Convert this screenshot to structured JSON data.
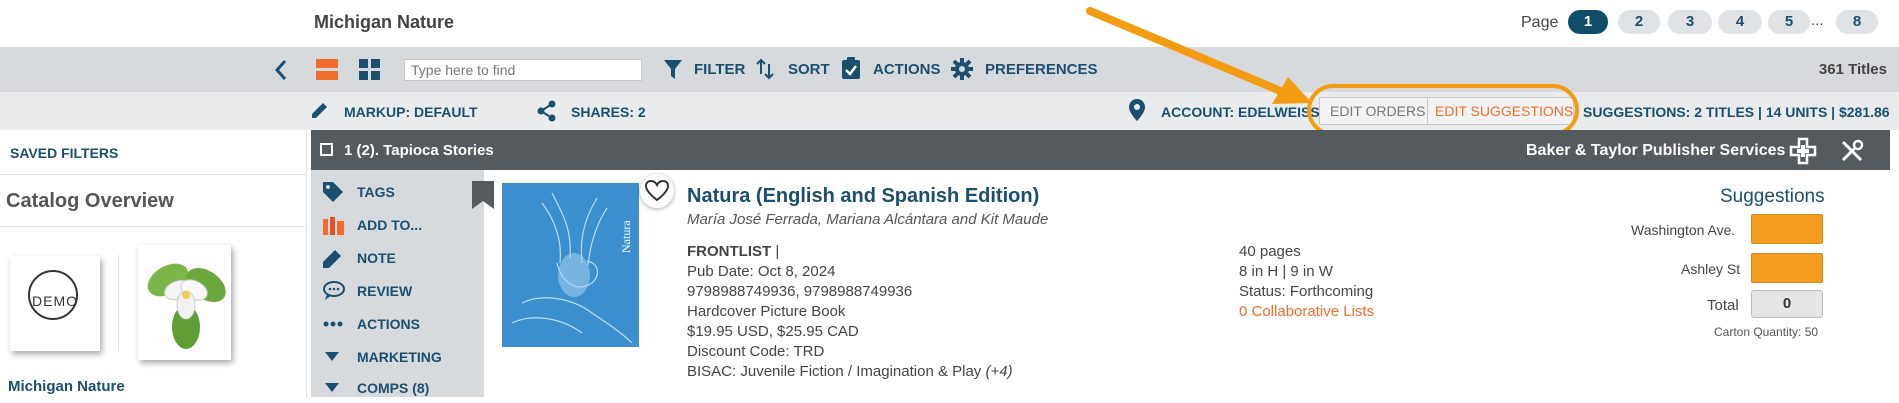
{
  "header": {
    "catalog_title": "Michigan Nature",
    "page_label": "Page",
    "pages": [
      "1",
      "2",
      "3",
      "4",
      "5",
      "8"
    ],
    "active_page": "1",
    "ellipsis": "..."
  },
  "toolbar": {
    "search_placeholder": "Type here to find",
    "filter_label": "FILTER",
    "sort_label": "SORT",
    "actions_label": "ACTIONS",
    "preferences_label": "PREFERENCES",
    "titles_count": "361 Titles"
  },
  "bar2": {
    "markup_label": "MARKUP: DEFAULT",
    "shares_label": "SHARES: 2",
    "account_label": "ACCOUNT: EDELWEISS",
    "edit_orders_label": "EDIT ORDERS",
    "edit_suggestions_label": "EDIT SUGGESTIONS",
    "suggestions_summary": "SUGGESTIONS: 2 TITLES | 14 UNITS | $281.86"
  },
  "left_panel": {
    "saved_filters": "SAVED FILTERS",
    "catalog_overview": "Catalog Overview",
    "demo_text": "DEMO",
    "catalog_link": "Michigan Nature"
  },
  "title_bar": {
    "title_text": "1 (2). Tapioca Stories",
    "publisher": "Baker & Taylor Publisher Services"
  },
  "actions_sidebar": {
    "items": [
      "TAGS",
      "ADD TO...",
      "NOTE",
      "REVIEW",
      "ACTIONS",
      "MARKETING",
      "COMPS (8)"
    ]
  },
  "product": {
    "cover_text": "Natura",
    "title": "Natura (English and Spanish Edition)",
    "authors": "María José Ferrada, Mariana Alcántara and Kit Maude",
    "frontlist": "FRONTLIST",
    "frontlist_sep": "|",
    "pub_date": "Pub Date: Oct 8, 2024",
    "isbns": "9798988749936, 9798988749936",
    "format": "Hardcover Picture Book",
    "price": "$19.95 USD, $25.95 CAD",
    "discount": "Discount Code: TRD",
    "bisac": "BISAC: Juvenile Fiction / Imagination & Play",
    "bisac_more": "(+4)",
    "pages": "40 pages",
    "dimensions": "8 in H | 9 in W",
    "status": "Status: Forthcoming",
    "collab_lists": "0 Collaborative Lists"
  },
  "suggestions": {
    "title": "Suggestions",
    "rows": [
      "Washington Ave.",
      "Ashley St"
    ],
    "total_label": "Total",
    "total_value": "0",
    "carton_qty": "Carton Quantity: 50"
  },
  "colors": {
    "accent_orange": "#f39c12",
    "primary_blue": "#1c4f6e",
    "link_orange": "#f06d2c"
  }
}
